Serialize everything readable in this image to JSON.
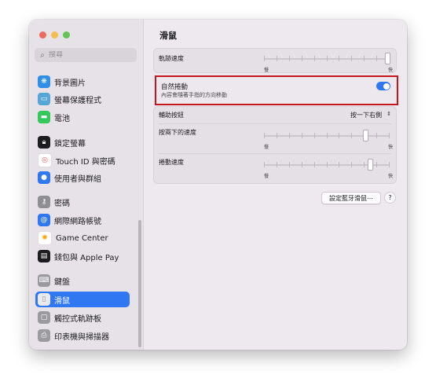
{
  "search": {
    "placeholder": "搜尋"
  },
  "sidebar": {
    "items": [
      {
        "label": "背景圖片",
        "icon": "wallpaper-icon",
        "color": "#2f8ee6"
      },
      {
        "label": "螢幕保護程式",
        "icon": "screensaver-icon",
        "color": "#57a6d8"
      },
      {
        "label": "電池",
        "icon": "battery-icon",
        "color": "#34c759"
      },
      {
        "label": "鎖定螢幕",
        "icon": "lock-icon",
        "color": "#1d1d1f"
      },
      {
        "label": "Touch ID 與密碼",
        "icon": "fingerprint-icon",
        "color": "#f05a5a"
      },
      {
        "label": "使用者與群組",
        "icon": "users-icon",
        "color": "#2f78f2"
      },
      {
        "label": "密碼",
        "icon": "key-icon",
        "color": "#8e8e93"
      },
      {
        "label": "網際網路帳號",
        "icon": "at-icon",
        "color": "#2f78f2"
      },
      {
        "label": "Game Center",
        "icon": "game-center-icon",
        "color": "#ff9f0a"
      },
      {
        "label": "錢包與 Apple Pay",
        "icon": "wallet-icon",
        "color": "#1d1d1f"
      },
      {
        "label": "鍵盤",
        "icon": "keyboard-icon",
        "color": "#9a9a9f"
      },
      {
        "label": "滑鼠",
        "icon": "mouse-icon",
        "color": "#9a9a9f",
        "selected": true
      },
      {
        "label": "觸控式軌跡板",
        "icon": "trackpad-icon",
        "color": "#9a9a9f"
      },
      {
        "label": "印表機與掃描器",
        "icon": "printer-icon",
        "color": "#9a9a9f"
      }
    ]
  },
  "main": {
    "title": "滑鼠",
    "tracking_speed": {
      "label": "軌跡速度",
      "min_label": "慢",
      "max_label": "快",
      "value": 1.0
    },
    "natural_scrolling": {
      "label": "自然捲動",
      "description": "內容會隨著手指的方向移動",
      "enabled": true
    },
    "secondary_click": {
      "label": "輔助按鈕",
      "value": "按一下右側"
    },
    "double_click_speed": {
      "label": "按兩下的速度",
      "min_label": "慢",
      "max_label": "快",
      "value": 0.82
    },
    "scrolling_speed": {
      "label": "捲動速度",
      "min_label": "慢",
      "max_label": "快",
      "value": 0.86
    },
    "setup_button": "設定藍牙滑鼠⋯",
    "help_button": "?"
  }
}
